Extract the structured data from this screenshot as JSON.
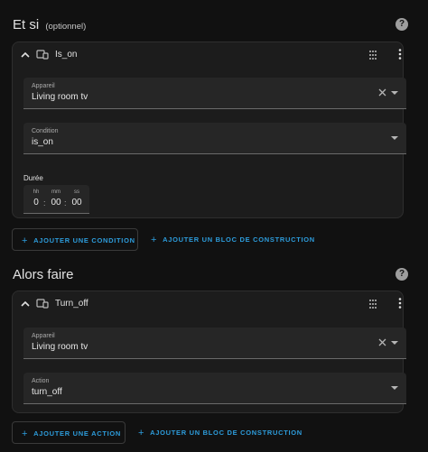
{
  "condition_section": {
    "title": "Et si",
    "subtitle": "(optionnel)",
    "help_icon": "help-circle-icon",
    "card": {
      "title": "Is_on",
      "device_label": "Appareil",
      "device_value": "Living room tv",
      "condition_label": "Condition",
      "condition_value": "is_on",
      "duration_label": "Durée",
      "duration": {
        "hh_label": "hh",
        "hh": "0",
        "mm_label": "mm",
        "mm": "00",
        "ss_label": "ss",
        "ss": "00",
        "separator": ":"
      }
    },
    "add_condition_label": "AJOUTER UNE CONDITION",
    "add_building_block_label": "AJOUTER UN BLOC DE CONSTRUCTION"
  },
  "action_section": {
    "title": "Alors faire",
    "help_icon": "help-circle-icon",
    "card": {
      "title": "Turn_off",
      "device_label": "Appareil",
      "device_value": "Living room tv",
      "action_label": "Action",
      "action_value": "turn_off"
    },
    "add_action_label": "AJOUTER UNE ACTION",
    "add_building_block_label": "AJOUTER UN BLOC DE CONSTRUCTION"
  },
  "colors": {
    "background": "#111111",
    "card": "#1c1c1c",
    "field": "#262626",
    "accent": "#2d9cdb"
  }
}
